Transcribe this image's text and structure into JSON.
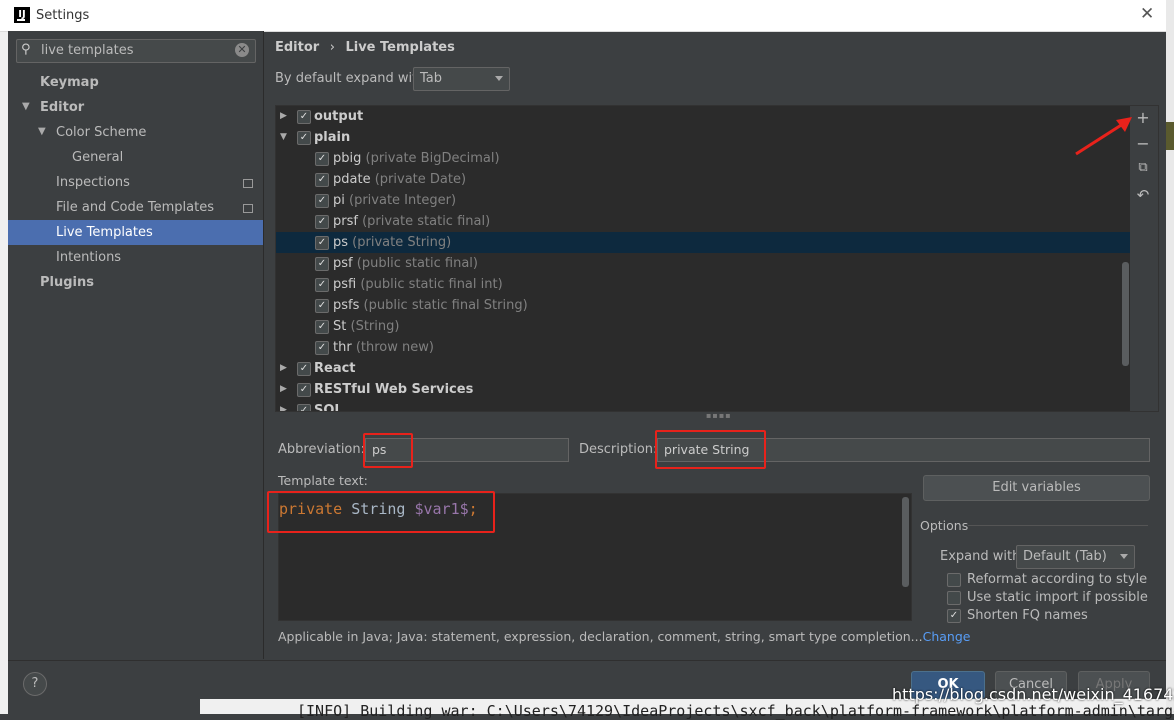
{
  "window": {
    "title": "Settings",
    "logo": "IJ"
  },
  "sidebar": {
    "search": {
      "value": "live templates"
    },
    "items": [
      {
        "label": "Keymap"
      },
      {
        "label": "Editor"
      },
      {
        "label": "Color Scheme"
      },
      {
        "label": "General"
      },
      {
        "label": "Inspections"
      },
      {
        "label": "File and Code Templates"
      },
      {
        "label": "Live Templates"
      },
      {
        "label": "Intentions"
      },
      {
        "label": "Plugins"
      }
    ]
  },
  "breadcrumb": {
    "parent": "Editor",
    "sep": "›",
    "current": "Live Templates"
  },
  "expand": {
    "label": "By default expand with",
    "value": "Tab"
  },
  "tree": {
    "groups": {
      "output": "output",
      "plain": "plain",
      "react": "React",
      "restful": "RESTful Web Services",
      "sql": "SQL"
    },
    "templates": [
      {
        "abbr": "pbig",
        "desc": "(private BigDecimal)"
      },
      {
        "abbr": "pdate",
        "desc": "(private Date)"
      },
      {
        "abbr": "pi",
        "desc": "(private Integer)"
      },
      {
        "abbr": "prsf",
        "desc": "(private static final)"
      },
      {
        "abbr": "ps",
        "desc": "(private String)"
      },
      {
        "abbr": "psf",
        "desc": "(public static final)"
      },
      {
        "abbr": "psfi",
        "desc": "(public static final int)"
      },
      {
        "abbr": "psfs",
        "desc": "(public static final String)"
      },
      {
        "abbr": "St",
        "desc": "(String)"
      },
      {
        "abbr": "thr",
        "desc": "(throw new)"
      }
    ]
  },
  "fields": {
    "abbr_label": "Abbreviation:",
    "abbr_value": "ps",
    "desc_label": "Description:",
    "desc_value": "private String"
  },
  "template_text": {
    "label": "Template text:",
    "kw": "private",
    "type": "String",
    "var": "$var1$",
    "end": ";"
  },
  "options": {
    "edit_variables": "Edit variables",
    "title": "Options",
    "expand_label": "Expand with",
    "expand_value": "Default (Tab)",
    "reformat": "Reformat according to style",
    "static_import": "Use static import if possible",
    "shorten": "Shorten FQ names"
  },
  "applicable": {
    "text": "Applicable in Java; Java: statement, expression, declaration, comment, string, smart type completion...",
    "link": "Change"
  },
  "buttons": {
    "help": "?",
    "ok": "OK",
    "cancel": "Cancel",
    "apply": "Apply"
  },
  "console": "[INFO] Building war: C:\\Users\\74129\\IdeaProjects\\sxcf_back\\platform-framework\\platform-admin\\target",
  "watermark": "https://blog.csdn.net/weixin_41674292",
  "colors": {
    "accent": "#4b6eaf",
    "highlight": "#e8221b",
    "link": "#589df6"
  }
}
